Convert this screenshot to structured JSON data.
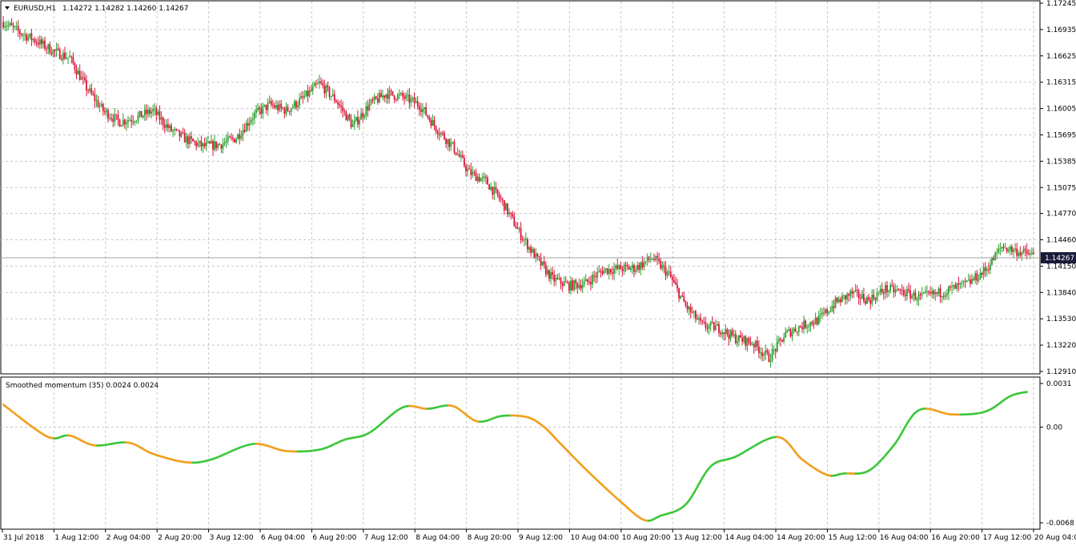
{
  "main_panel": {
    "symbol": "EURUSD,H1",
    "ohlc": "1.14272 1.14282 1.14260 1.14267",
    "current_price_label": "1.14267"
  },
  "indicator_panel": {
    "title": "Smoothed momentum (35) 0.0024 0.0024"
  },
  "colors": {
    "bull_candle": "#2ca02c",
    "bear_candle": "#dc143c",
    "momentum_up": "#3cc83c",
    "momentum_down": "#f0a01e",
    "grid": "#c8c8c8",
    "price_tag_bg": "#1a1a3a"
  },
  "chart_data": [
    {
      "type": "candlestick",
      "title": "EURUSD,H1",
      "ylim": [
        1.1291,
        1.17245
      ],
      "y_ticks": [
        "1.17245",
        "1.16935",
        "1.16625",
        "1.16315",
        "1.16005",
        "1.15695",
        "1.15385",
        "1.15075",
        "1.14770",
        "1.14460",
        "1.14150",
        "1.13840",
        "1.13530",
        "1.13220",
        "1.12910"
      ],
      "x_ticks": [
        "31 Jul 2018",
        "1 Aug 12:00",
        "2 Aug 04:00",
        "2 Aug 20:00",
        "3 Aug 12:00",
        "6 Aug 04:00",
        "6 Aug 20:00",
        "7 Aug 12:00",
        "8 Aug 04:00",
        "8 Aug 20:00",
        "9 Aug 12:00",
        "10 Aug 04:00",
        "10 Aug 20:00",
        "13 Aug 12:00",
        "14 Aug 04:00",
        "14 Aug 20:00",
        "15 Aug 12:00",
        "16 Aug 04:00",
        "16 Aug 20:00",
        "17 Aug 12:00",
        "20 Aug 04:00"
      ],
      "close_path": [
        [
          0,
          1.1702
        ],
        [
          10,
          1.169
        ],
        [
          20,
          1.168
        ],
        [
          30,
          1.1668
        ],
        [
          40,
          1.166
        ],
        [
          50,
          1.1625
        ],
        [
          60,
          1.1598
        ],
        [
          70,
          1.1585
        ],
        [
          80,
          1.159
        ],
        [
          90,
          1.1598
        ],
        [
          100,
          1.1576
        ],
        [
          110,
          1.1564
        ],
        [
          120,
          1.1556
        ],
        [
          130,
          1.1558
        ],
        [
          140,
          1.1566
        ],
        [
          150,
          1.1592
        ],
        [
          160,
          1.1605
        ],
        [
          170,
          1.1598
        ],
        [
          180,
          1.1612
        ],
        [
          190,
          1.163
        ],
        [
          200,
          1.161
        ],
        [
          210,
          1.158
        ],
        [
          220,
          1.1605
        ],
        [
          230,
          1.1618
        ],
        [
          240,
          1.1614
        ],
        [
          250,
          1.1605
        ],
        [
          260,
          1.1578
        ],
        [
          270,
          1.1556
        ],
        [
          280,
          1.1525
        ],
        [
          290,
          1.1515
        ],
        [
          300,
          1.149
        ],
        [
          310,
          1.1455
        ],
        [
          320,
          1.1425
        ],
        [
          330,
          1.14
        ],
        [
          340,
          1.1392
        ],
        [
          350,
          1.1395
        ],
        [
          360,
          1.141
        ],
        [
          370,
          1.1412
        ],
        [
          380,
          1.1413
        ],
        [
          390,
          1.1425
        ],
        [
          400,
          1.1405
        ],
        [
          410,
          1.1368
        ],
        [
          420,
          1.1345
        ],
        [
          430,
          1.1342
        ],
        [
          440,
          1.133
        ],
        [
          450,
          1.1325
        ],
        [
          460,
          1.1307
        ],
        [
          470,
          1.1335
        ],
        [
          480,
          1.1345
        ],
        [
          490,
          1.1352
        ],
        [
          500,
          1.1372
        ],
        [
          510,
          1.1383
        ],
        [
          520,
          1.1375
        ],
        [
          530,
          1.1388
        ],
        [
          540,
          1.1385
        ],
        [
          550,
          1.1378
        ],
        [
          560,
          1.1382
        ],
        [
          570,
          1.1388
        ],
        [
          580,
          1.1395
        ],
        [
          590,
          1.141
        ],
        [
          600,
          1.1438
        ],
        [
          610,
          1.1432
        ],
        [
          620,
          1.1427
        ]
      ],
      "n_bars": 620
    },
    {
      "type": "line",
      "title": "Smoothed momentum (35) 0.0024 0.0024",
      "ylim": [
        -0.0068,
        0.0031
      ],
      "y_ticks": [
        "0.0031",
        "0.00",
        "-0.0068"
      ],
      "x": [
        0,
        20,
        30,
        40,
        55,
        75,
        90,
        110,
        125,
        150,
        170,
        190,
        205,
        220,
        240,
        255,
        270,
        285,
        300,
        315,
        325,
        335,
        350,
        370,
        385,
        395,
        410,
        425,
        440,
        465,
        480,
        495,
        505,
        520,
        535,
        550,
        570,
        590,
        605,
        615
      ],
      "values": [
        0.0016,
        -0.0002,
        -0.0008,
        -0.0006,
        -0.0013,
        -0.0011,
        -0.0019,
        -0.0025,
        -0.0023,
        -0.0012,
        -0.0017,
        -0.0016,
        -0.0009,
        -0.0004,
        0.0014,
        0.0013,
        0.0015,
        0.0004,
        0.0008,
        0.0007,
        0.0,
        -0.0012,
        -0.003,
        -0.0052,
        -0.0066,
        -0.0063,
        -0.0055,
        -0.0028,
        -0.0021,
        -0.0007,
        -0.0023,
        -0.0034,
        -0.0033,
        -0.0031,
        -0.0013,
        0.0012,
        0.0009,
        0.0011,
        0.0022,
        0.0025
      ]
    }
  ]
}
